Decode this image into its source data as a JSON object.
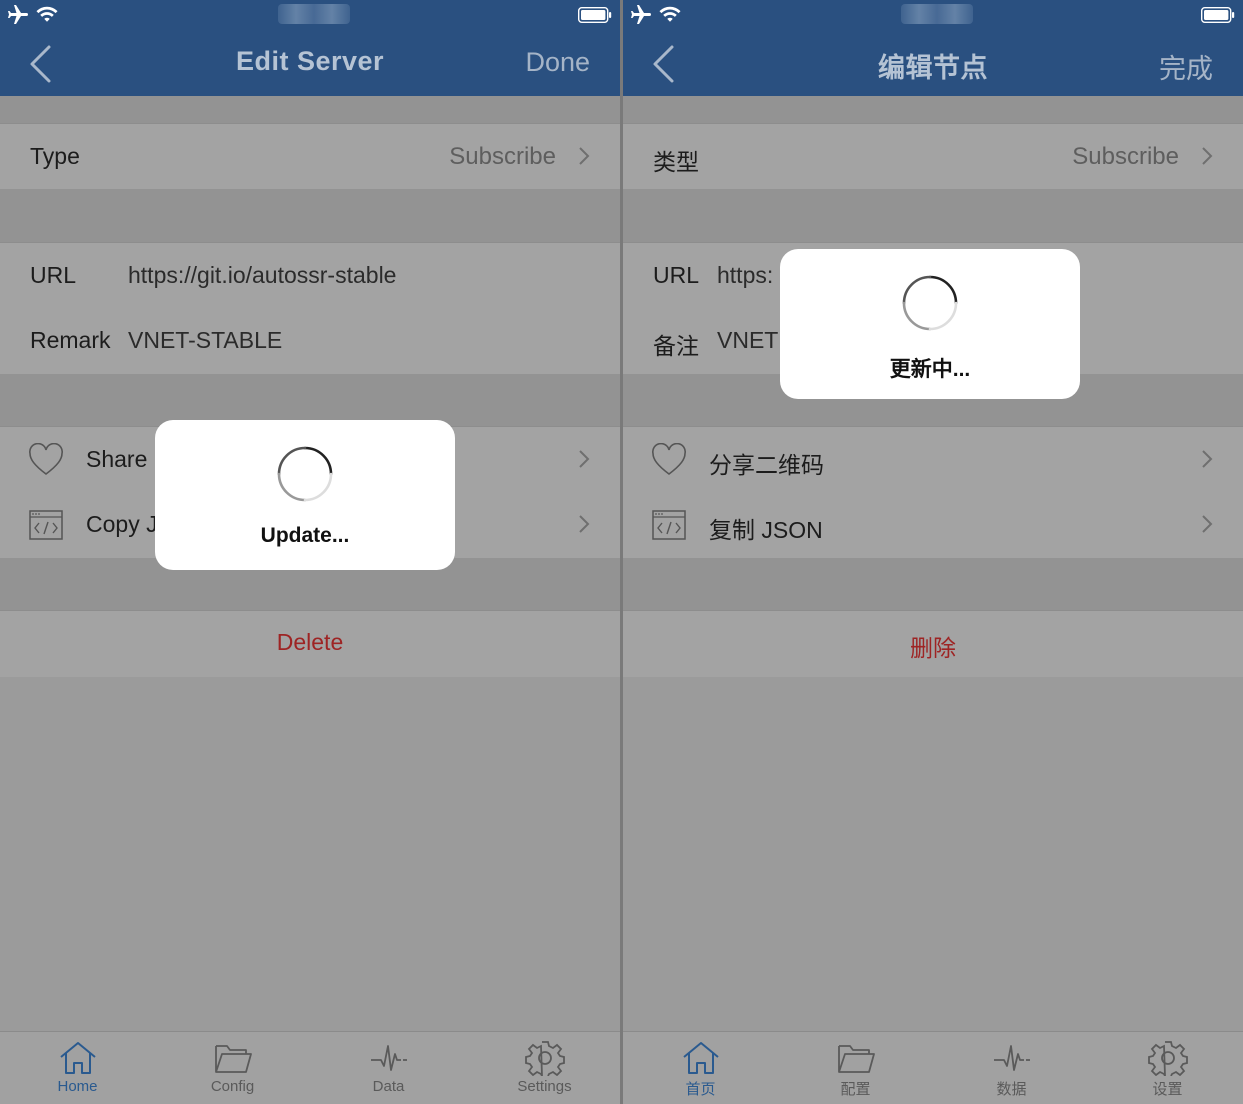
{
  "colors": {
    "nav_bar": "#2a5080",
    "delete_text": "#9e2424",
    "active_tab": "#2a5a8f"
  },
  "left": {
    "nav": {
      "title": "Edit Server",
      "done": "Done"
    },
    "type": {
      "label": "Type",
      "value": "Subscribe"
    },
    "url": {
      "label": "URL",
      "value": "https://git.io/autossr-stable"
    },
    "remark": {
      "label": "Remark",
      "value": "VNET-STABLE"
    },
    "share": {
      "label": "Share"
    },
    "copy": {
      "label": "Copy J"
    },
    "delete": "Delete",
    "hud": "Update...",
    "tabs": [
      "Home",
      "Config",
      "Data",
      "Settings"
    ]
  },
  "right": {
    "nav": {
      "title": "编辑节点",
      "done": "完成"
    },
    "type": {
      "label": "类型",
      "value": "Subscribe"
    },
    "url": {
      "label": "URL",
      "value": "https:"
    },
    "remark": {
      "label": "备注",
      "value": "VNET"
    },
    "share": {
      "label": "分享二维码"
    },
    "copy": {
      "label": "复制 JSON"
    },
    "delete": "删除",
    "hud": "更新中...",
    "tabs": [
      "首页",
      "配置",
      "数据",
      "设置"
    ]
  },
  "icons": {
    "status": [
      "airplane-icon",
      "wifi-icon",
      "battery-icon"
    ],
    "rows": [
      "heart-icon",
      "code-window-icon",
      "chevron-right-icon"
    ],
    "tabs": [
      "home-icon",
      "folder-icon",
      "pulse-icon",
      "gear-icon"
    ]
  }
}
